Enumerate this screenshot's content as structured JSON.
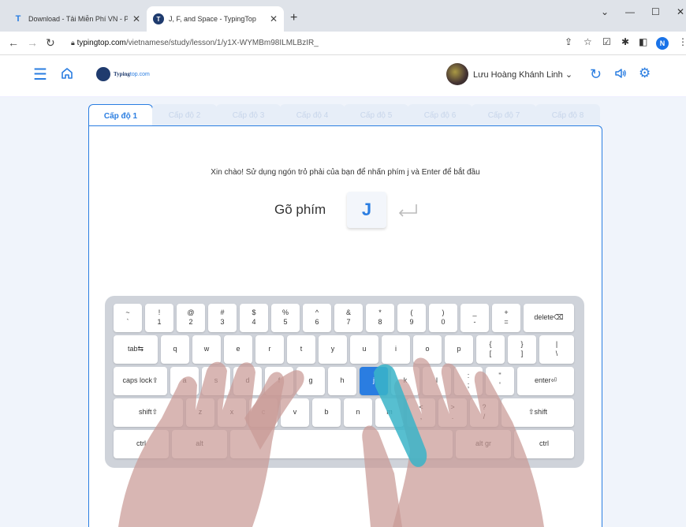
{
  "browser": {
    "tabs": [
      {
        "title": "Download - Tải Miễn Phí VN - Ph",
        "favicon": "T",
        "active": false
      },
      {
        "title": "J, F, and Space - TypingTop",
        "favicon": "T",
        "active": true
      }
    ],
    "url_host": "typingtop.com",
    "url_path": "/vietnamese/study/lesson/1/y1X-WYMBm98ILMLBzIR_",
    "profile_initial": "N"
  },
  "header": {
    "logo_word1": "Typing",
    "logo_word2": "top.com",
    "username": "Lưu Hoàng Khánh Linh"
  },
  "levels": [
    "Cấp độ 1",
    "Cấp độ 2",
    "Cấp độ 3",
    "Cấp độ 4",
    "Cấp độ 5",
    "Cấp độ 6",
    "Cấp độ 7",
    "Cấp độ 8"
  ],
  "lesson": {
    "instruction": "Xin chào! Sử dụng ngón trỏ phải của bạn để nhấn phím j và Enter để bắt đầu",
    "type_label": "Gõ phím",
    "target_key": "J"
  },
  "keyboard": {
    "row1": [
      [
        "~",
        "`"
      ],
      [
        "!",
        "1"
      ],
      [
        "@",
        "2"
      ],
      [
        "#",
        "3"
      ],
      [
        "$",
        "4"
      ],
      [
        "%",
        "5"
      ],
      [
        "^",
        "6"
      ],
      [
        "&",
        "7"
      ],
      [
        "*",
        "8"
      ],
      [
        "(",
        "9"
      ],
      [
        ")",
        "0"
      ],
      [
        "_",
        "-"
      ],
      [
        "+",
        "="
      ]
    ],
    "delete": "delete⌫",
    "row2_tab": "tab⇆",
    "row2": [
      "q",
      "w",
      "e",
      "r",
      "t",
      "y",
      "u",
      "i",
      "o",
      "p"
    ],
    "row2_br": [
      [
        "{",
        "["
      ],
      [
        "}",
        "]"
      ],
      [
        "|",
        "\\"
      ]
    ],
    "caps": "caps lock⇪",
    "row3": [
      "a",
      "s",
      "d",
      "f",
      "g",
      "h",
      "j",
      "k",
      "l"
    ],
    "row3_p": [
      [
        ":",
        ";"
      ],
      [
        "\"",
        "'"
      ]
    ],
    "enter": "enter⏎",
    "shift_l": "shift⇧",
    "row4": [
      "z",
      "x",
      "c",
      "v",
      "b",
      "n",
      "m"
    ],
    "row4_p": [
      [
        "<",
        ","
      ],
      [
        ">",
        "."
      ],
      [
        "?",
        "/"
      ]
    ],
    "shift_r": "⇧shift",
    "ctrl": "ctrl",
    "alt": "alt",
    "altgr": "alt gr",
    "highlight": "j"
  },
  "colors": {
    "accent": "#2a7de1",
    "finger_active": "#39b4c8",
    "hands": "#c99a96"
  }
}
